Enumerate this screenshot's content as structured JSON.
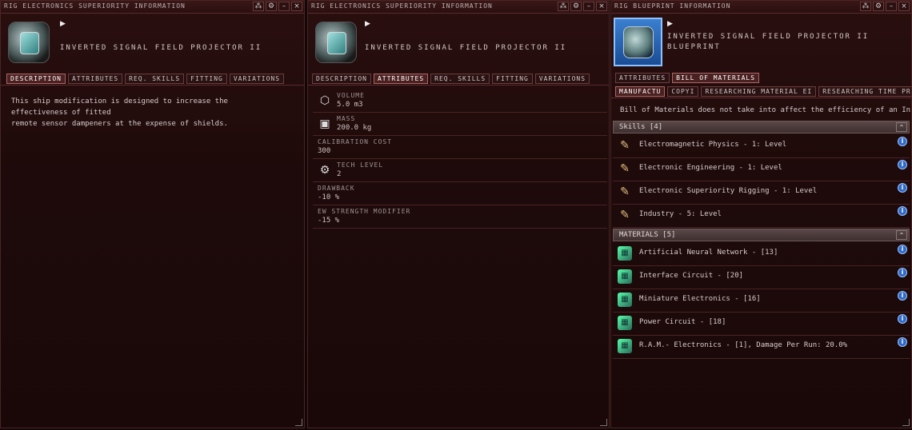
{
  "left_window": {
    "title": "RIG ELECTRONICS SUPERIORITY INFORMATION",
    "item_name": "INVERTED SIGNAL FIELD PROJECTOR II",
    "tabs": [
      "DESCRIPTION",
      "ATTRIBUTES",
      "REQ. SKILLS",
      "FITTING",
      "VARIATIONS"
    ],
    "active_tab": "DESCRIPTION",
    "description_line1": "This ship modification is designed to increase the effectiveness of fitted",
    "description_line2": "remote sensor dampeners at the expense of shields."
  },
  "middle_window": {
    "title": "RIG ELECTRONICS SUPERIORITY INFORMATION",
    "item_name": "INVERTED SIGNAL FIELD PROJECTOR II",
    "tabs": [
      "DESCRIPTION",
      "ATTRIBUTES",
      "REQ. SKILLS",
      "FITTING",
      "VARIATIONS"
    ],
    "active_tab": "ATTRIBUTES",
    "attributes": [
      {
        "label": "VOLUME",
        "value": "5.0 m3",
        "icon": "cube-icon"
      },
      {
        "label": "MASS",
        "value": "200.0 kg",
        "icon": "weight-icon"
      },
      {
        "label": "CALIBRATION COST",
        "value": "300",
        "icon": ""
      },
      {
        "label": "TECH LEVEL",
        "value": "2",
        "icon": "gear-icon"
      },
      {
        "label": "DRAWBACK",
        "value": "-10 %",
        "icon": ""
      },
      {
        "label": "EW STRENGTH MODIFIER",
        "value": "-15 %",
        "icon": ""
      }
    ]
  },
  "right_window": {
    "title": "RIG BLUEPRINT INFORMATION",
    "item_name": "INVERTED SIGNAL FIELD PROJECTOR II",
    "item_subtitle": "BLUEPRINT",
    "tabs_top": [
      "ATTRIBUTES",
      "BILL OF MATERIALS"
    ],
    "active_top": "BILL OF MATERIALS",
    "tabs_sub": [
      "MANUFACTU",
      "COPYI",
      "RESEARCHING MATERIAL EI",
      "RESEARCHING TIME PROD"
    ],
    "active_sub": "MANUFACTU",
    "note": "Bill of Materials does not take into affect the efficiency of an Installation",
    "skills_header": "Skills [4]",
    "skills": [
      "Electromagnetic Physics - 1: Level",
      "Electronic Engineering - 1: Level",
      "Electronic Superiority Rigging - 1: Level",
      "Industry - 5: Level"
    ],
    "materials_header": "MATERIALS [5]",
    "materials": [
      "Artificial Neural Network - [13]",
      "Interface Circuit - [20]",
      "Miniature Electronics - [16]",
      "Power Circuit - [18]",
      "R.A.M.- Electronics - [1], Damage Per Run: 20.0%"
    ]
  },
  "window_buttons": {
    "pin": "⁂",
    "settings": "⚙",
    "minimize": "–",
    "close": "×"
  },
  "info_glyph": "i",
  "collapse_glyph": "⌃"
}
